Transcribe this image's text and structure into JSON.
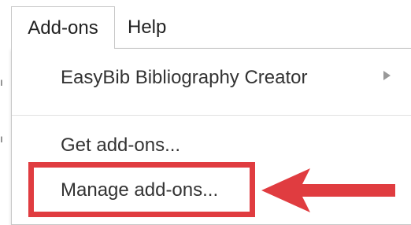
{
  "menubar": {
    "items": [
      {
        "label": "Add-ons",
        "active": true
      },
      {
        "label": "Help",
        "active": false
      }
    ]
  },
  "dropdown": {
    "items": [
      {
        "label": "EasyBib Bibliography Creator",
        "has_submenu": true
      },
      {
        "label": "Get add-ons..."
      },
      {
        "label": "Manage add-ons...",
        "highlighted": true
      }
    ]
  },
  "annotation": {
    "box_color": "#e03c40",
    "arrow_color": "#e03c40"
  },
  "icons": {
    "submenu": "submenu-arrow-icon",
    "pointer": "red-arrow-icon"
  }
}
